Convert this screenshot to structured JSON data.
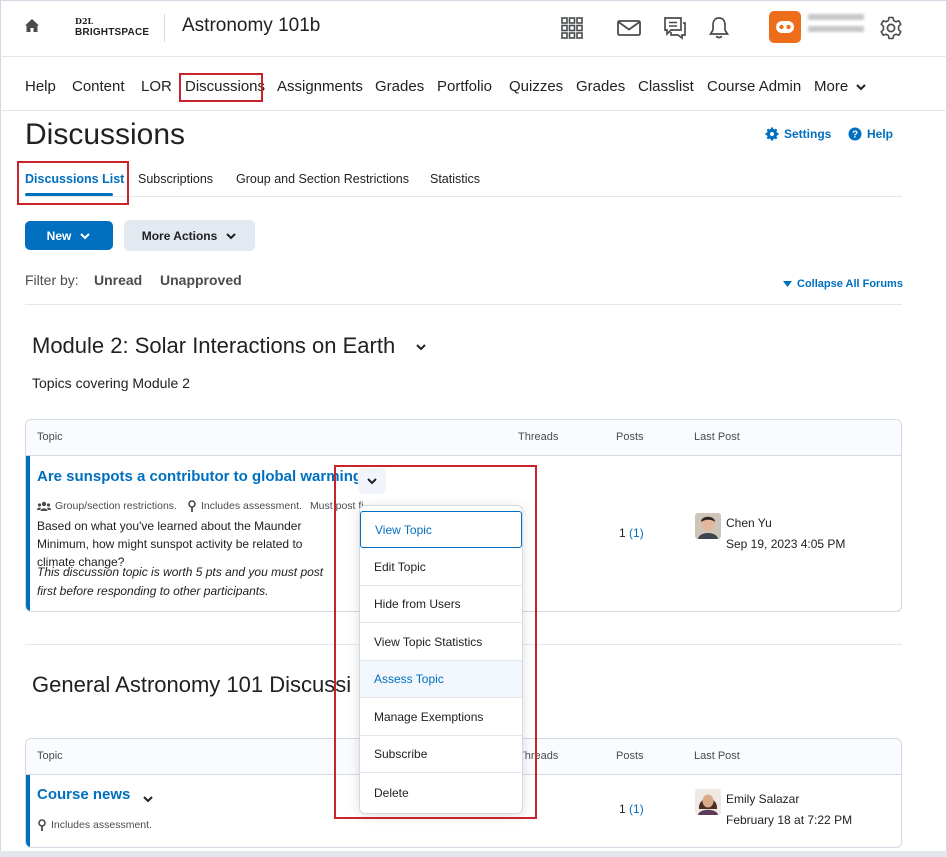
{
  "topbar": {
    "logo_line1": "D2L",
    "logo_line2": "BRIGHTSPACE",
    "course_title": "Astronomy 101b",
    "icons": [
      "home-icon",
      "apps-grid-icon",
      "mail-icon",
      "chat-icon",
      "bell-icon",
      "user-avatar-icon",
      "gear-icon"
    ]
  },
  "nav": {
    "items": [
      "Help",
      "Content",
      "LOR",
      "Discussions",
      "Assignments",
      "Grades",
      "Portfolio",
      "Quizzes",
      "Grades",
      "Classlist",
      "Course Admin",
      "More"
    ]
  },
  "page": {
    "title": "Discussions",
    "settings_label": "Settings",
    "help_label": "Help"
  },
  "tabs": [
    "Discussions List",
    "Subscriptions",
    "Group and Section Restrictions",
    "Statistics"
  ],
  "actions": {
    "new_label": "New",
    "more_actions_label": "More Actions"
  },
  "filter": {
    "label": "Filter by:",
    "options": [
      "Unread",
      "Unapproved"
    ],
    "collapse_label": "Collapse All Forums"
  },
  "columns": {
    "topic": "Topic",
    "threads": "Threads",
    "posts": "Posts",
    "last_post": "Last Post"
  },
  "forums": [
    {
      "title": "Module 2: Solar Interactions on Earth",
      "description": "Topics covering Module 2",
      "topic": {
        "title": "Are sunspots a contributor to global warming?",
        "meta_restrictions": "Group/section restrictions.",
        "meta_assessment": "Includes assessment.",
        "meta_must_post": "Must post fi",
        "body": "Based on what you've learned about the Maunder Minimum, how might sunspot activity be related to climate change?",
        "note": "This discussion topic is worth 5 pts and you must post first before responding to other participants.",
        "posts": "1",
        "posts_unread": "(1)",
        "last_post_author": "Chen Yu",
        "last_post_date": "Sep 19, 2023 4:05 PM"
      }
    },
    {
      "title": "General Astronomy 101 Discussi",
      "topic": {
        "title": "Course news",
        "meta_assessment": "Includes assessment.",
        "posts": "1",
        "posts_unread": "(1)",
        "last_post_author": "Emily Salazar",
        "last_post_date": "February 18 at 7:22 PM"
      }
    }
  ],
  "context_menu": {
    "items": [
      "View Topic",
      "Edit Topic",
      "Hide from Users",
      "View Topic Statistics",
      "Assess Topic",
      "Manage Exemptions",
      "Subscribe",
      "Delete"
    ]
  },
  "colors": {
    "brand_blue": "#006fbf",
    "highlight_red": "#c9242b",
    "avatar_orange": "#ed6d1a"
  }
}
